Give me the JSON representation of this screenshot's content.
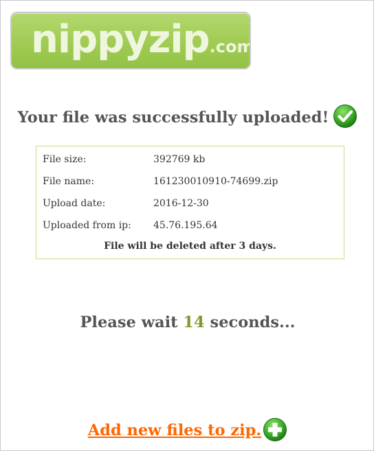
{
  "logo": {
    "main": "nippyzip",
    "sub": ".com"
  },
  "headline": "Your file was successfully uploaded!",
  "file_info": {
    "size_label": "File size:",
    "size_value": "392769 kb",
    "name_label": "File name:",
    "name_value": "161230010910-74699.zip",
    "date_label": "Upload date:",
    "date_value": "2016-12-30",
    "ip_label": "Uploaded from ip:",
    "ip_value": "45.76.195.64",
    "notice": "File will be deleted after 3 days."
  },
  "wait": {
    "prefix": "Please wait ",
    "seconds": "14",
    "suffix": " seconds..."
  },
  "add_link": "Add new files to zip.",
  "icons": {
    "success": "check-circle-icon",
    "add": "plus-circle-icon"
  },
  "colors": {
    "brand_green": "#a3cd58",
    "accent_link": "#ff6600",
    "countdown": "#7d9a28",
    "box_border": "#d7d68c"
  }
}
